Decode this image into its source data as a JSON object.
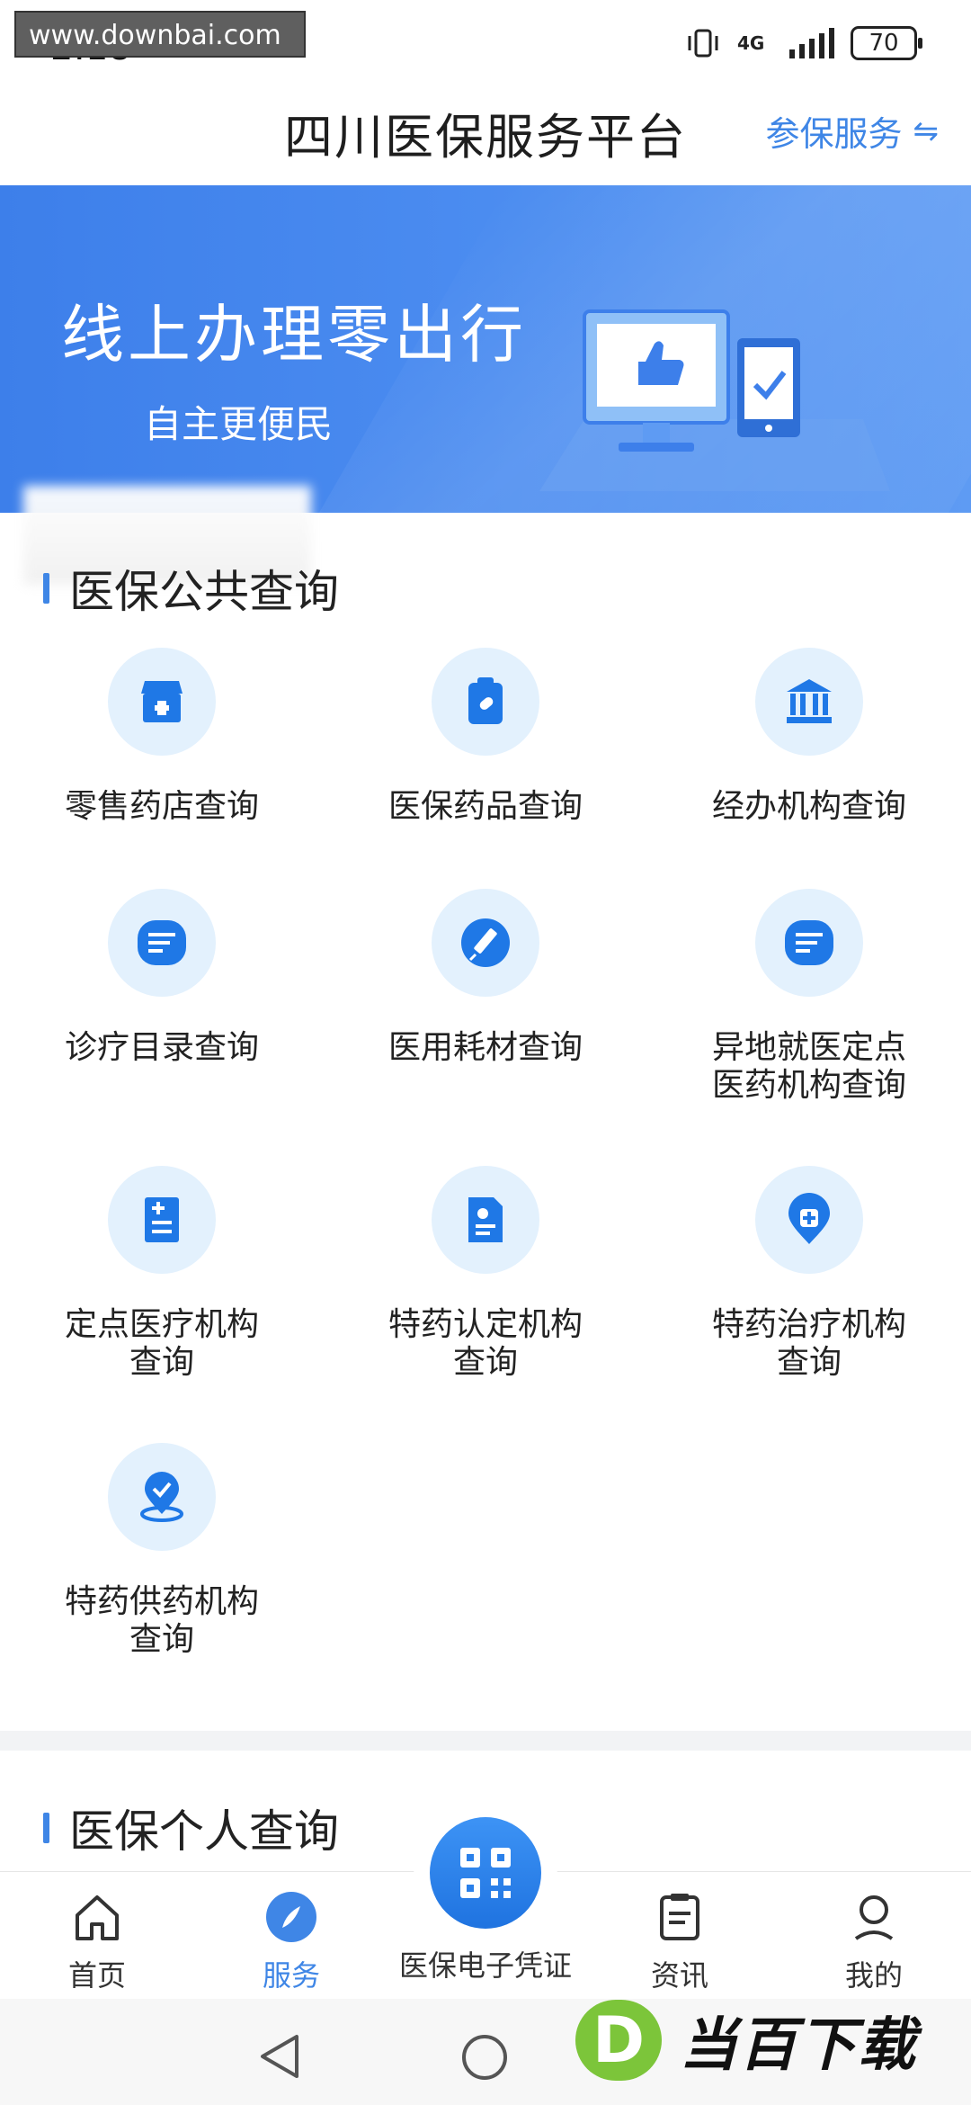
{
  "status_bar": {
    "time": "2:18",
    "network": "4G",
    "battery": "70"
  },
  "watermark": {
    "url": "www.downbai.com"
  },
  "header": {
    "title": "四川医保服务平台",
    "link_label": "参保服务"
  },
  "banner": {
    "title": "线上办理零出行",
    "subtitle": "自主更便民"
  },
  "public_section": {
    "title": "医保公共查询",
    "items": [
      {
        "label": "零售药店查询",
        "icon": "store-icon"
      },
      {
        "label": "医保药品查询",
        "icon": "medicine-icon"
      },
      {
        "label": "经办机构查询",
        "icon": "institution-icon"
      },
      {
        "label": "诊疗目录查询",
        "icon": "list-icon"
      },
      {
        "label": "医用耗材查询",
        "icon": "syringe-icon"
      },
      {
        "label": "异地就医定点\n医药机构查询",
        "icon": "message-icon"
      },
      {
        "label": "定点医疗机构\n查询",
        "icon": "medical-record-icon"
      },
      {
        "label": "特药认定机构\n查询",
        "icon": "certificate-icon"
      },
      {
        "label": "特药治疗机构\n查询",
        "icon": "location-plus-icon"
      },
      {
        "label": "特药供药机构\n查询",
        "icon": "location-check-icon"
      }
    ]
  },
  "personal_section": {
    "title": "医保个人查询"
  },
  "bottom_nav": {
    "items": [
      {
        "label": "首页",
        "icon": "home-icon"
      },
      {
        "label": "服务",
        "icon": "compass-icon"
      },
      {
        "label": "医保电子凭证",
        "icon": "qrcode-icon"
      },
      {
        "label": "资讯",
        "icon": "news-icon"
      },
      {
        "label": "我的",
        "icon": "user-icon"
      }
    ]
  },
  "brand": {
    "letter": "D",
    "name": "当百下载"
  },
  "colors": {
    "accent": "#3f86e6",
    "banner": "#4b8cf0",
    "icon_bg": "#e3f1fd"
  }
}
